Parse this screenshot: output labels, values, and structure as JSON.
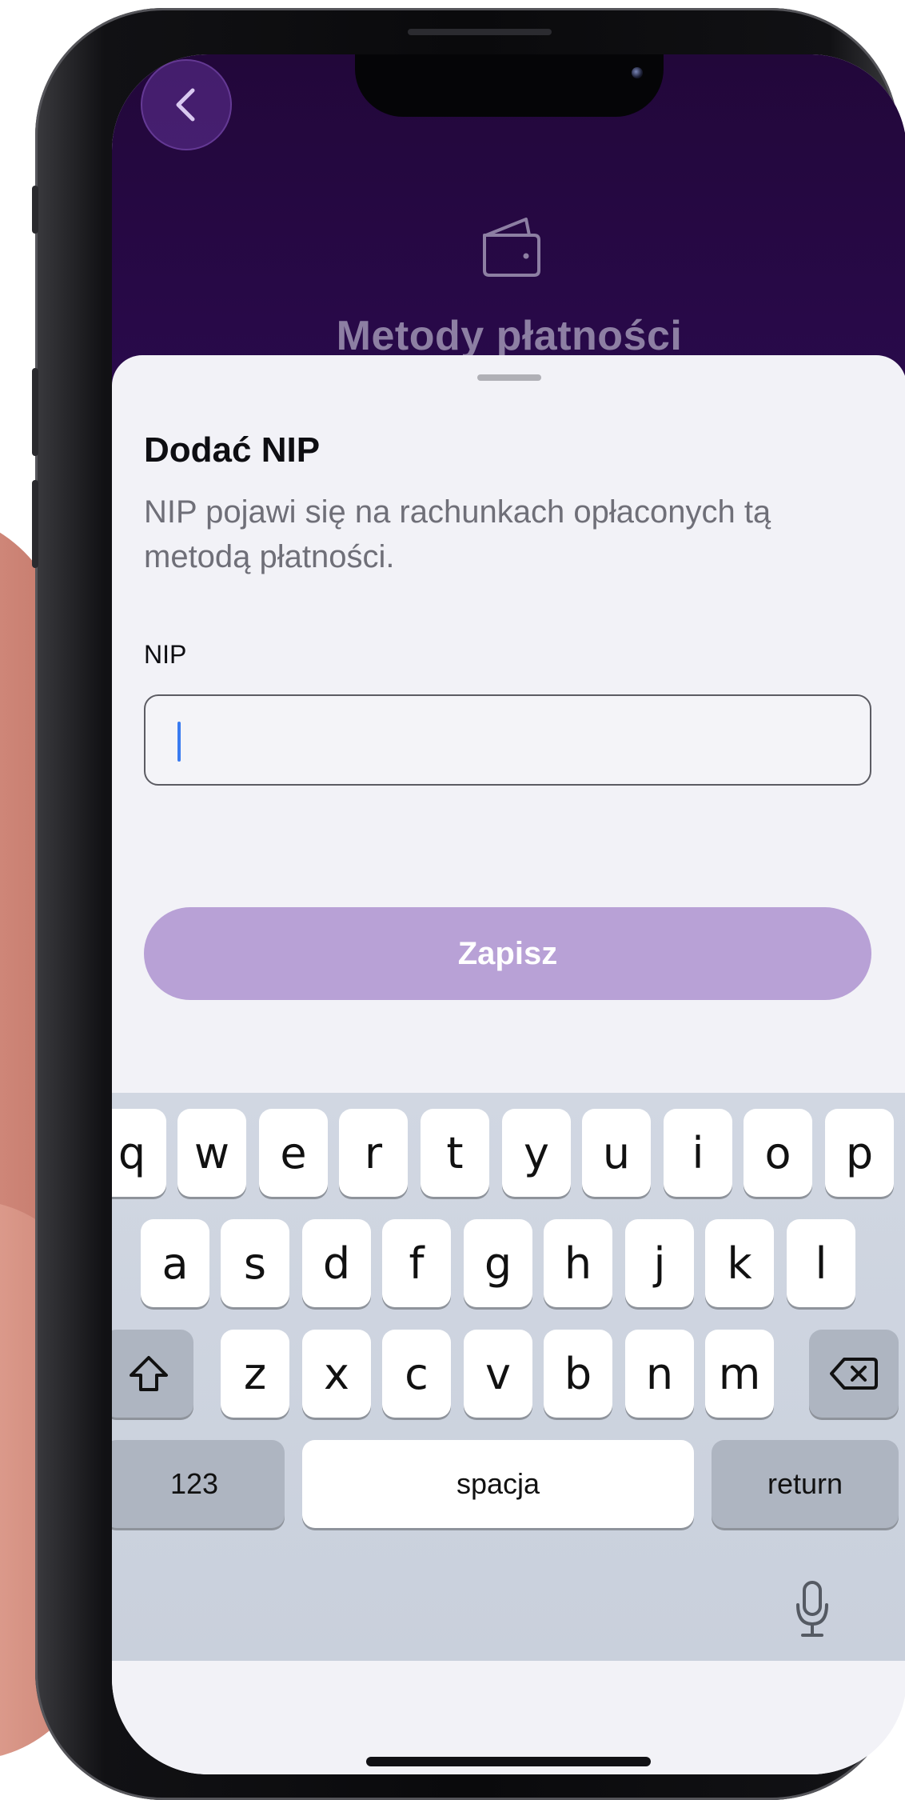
{
  "header": {
    "title": "Metody płatności",
    "back_icon": "chevron-left-icon",
    "wallet_icon": "wallet-icon"
  },
  "sheet": {
    "title": "Dodać NIP",
    "description": "NIP pojawi się na rachunkach opłaconych tą metodą płatności.",
    "field_label": "NIP",
    "input_value": "",
    "input_placeholder": "",
    "save_label": "Zapisz"
  },
  "keyboard": {
    "row1": [
      "q",
      "w",
      "e",
      "r",
      "t",
      "y",
      "u",
      "i",
      "o",
      "p"
    ],
    "row2": [
      "a",
      "s",
      "d",
      "f",
      "g",
      "h",
      "j",
      "k",
      "l"
    ],
    "row3": [
      "z",
      "x",
      "c",
      "v",
      "b",
      "n",
      "m"
    ],
    "numbers_label": "123",
    "space_label": "spacja",
    "return_label": "return",
    "shift_icon": "shift-icon",
    "delete_icon": "delete-icon",
    "mic_icon": "microphone-icon"
  },
  "colors": {
    "header_bg": "#22073a",
    "title_muted": "#8d7fa3",
    "button_bg": "#b8a1d6",
    "caret": "#3a7bf0"
  }
}
